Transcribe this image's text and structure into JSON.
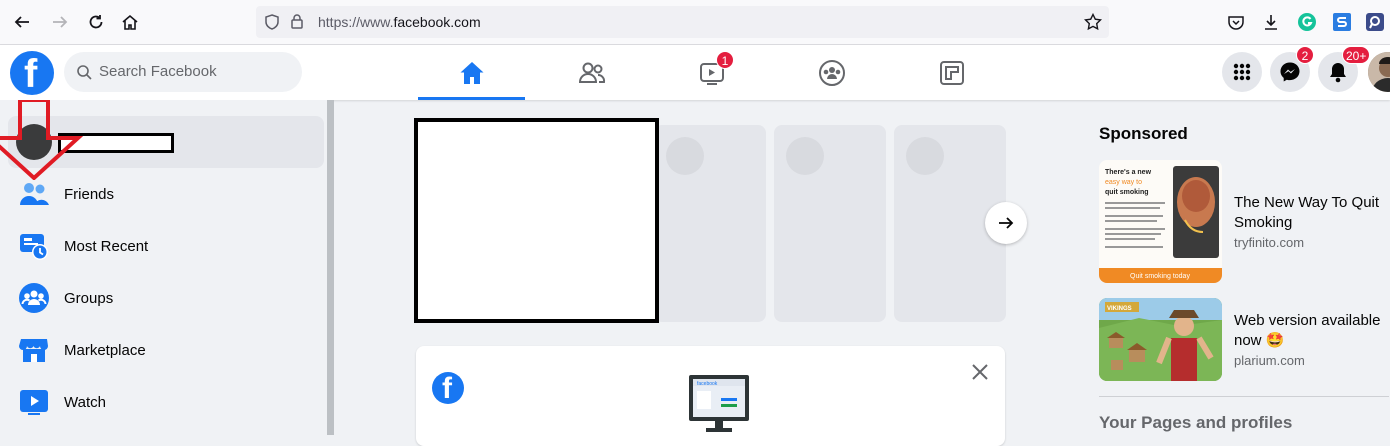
{
  "browser": {
    "url_prefix": "https://www.",
    "url_domain": "facebook.com"
  },
  "header": {
    "logo": "f",
    "search_placeholder": "Search Facebook",
    "watch_badge": "1",
    "messenger_badge": "2",
    "notifications_badge": "20+"
  },
  "sidebar": {
    "items": [
      {
        "label": "Friends",
        "icon": "friends-icon"
      },
      {
        "label": "Most Recent",
        "icon": "most-recent-icon"
      },
      {
        "label": "Groups",
        "icon": "groups-icon"
      },
      {
        "label": "Marketplace",
        "icon": "marketplace-icon"
      },
      {
        "label": "Watch",
        "icon": "watch-icon"
      }
    ]
  },
  "right": {
    "sponsored_heading": "Sponsored",
    "ads": [
      {
        "title": "The New Way To Quit Smoking",
        "domain": "tryfinito.com"
      },
      {
        "title": "Web version available now 🤩",
        "domain": "plarium.com"
      }
    ],
    "pages_heading": "Your Pages and profiles"
  },
  "ad1_image": {
    "headline_1": "There's a new",
    "headline_2": "easy way to",
    "headline_3": "quit smoking",
    "cta": "Quit smoking today"
  },
  "ad2_image": {
    "label": "VIKINGS"
  },
  "card": {
    "monitor_label": "facebook"
  },
  "colors": {
    "brand": "#1877f2",
    "badge": "#e41e3f",
    "annotation_arrow": "#e01b24"
  }
}
